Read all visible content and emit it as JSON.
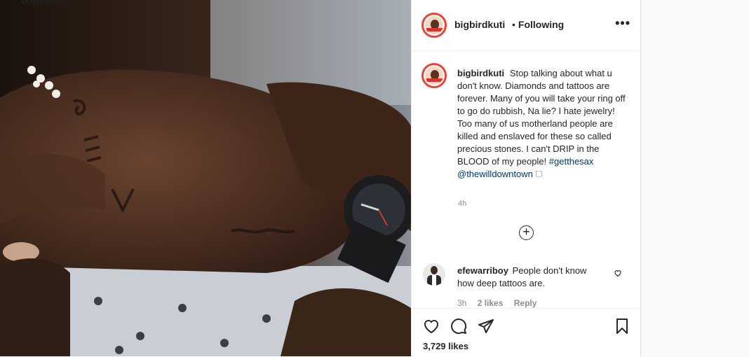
{
  "post": {
    "brand_text": "Downtown",
    "username": "bigbirdkuti",
    "follow_separator": "•",
    "follow_status": "Following",
    "more_icon": "•••",
    "caption": {
      "username": "bigbirdkuti",
      "text": "Stop talking about what u don't know. Diamonds and tattoos are forever. Many of you will take your ring off to go do rubbish, Na lie? I hate jewelry! Too many of us motherland people are killed and enslaved for these so called precious stones. I can't DRIP in the BLOOD of my people!",
      "hashtag": "#getthesax",
      "mention": "@thewilldowntown",
      "trailing_glyph": "🗆"
    },
    "time_ago": "4h",
    "add_icon": "+",
    "comments": [
      {
        "username": "efewarriboy",
        "text": "People don't know how deep tattoos are.",
        "time": "3h",
        "likes": "2 likes",
        "reply": "Reply"
      }
    ],
    "likes_count": "3,729 likes"
  }
}
